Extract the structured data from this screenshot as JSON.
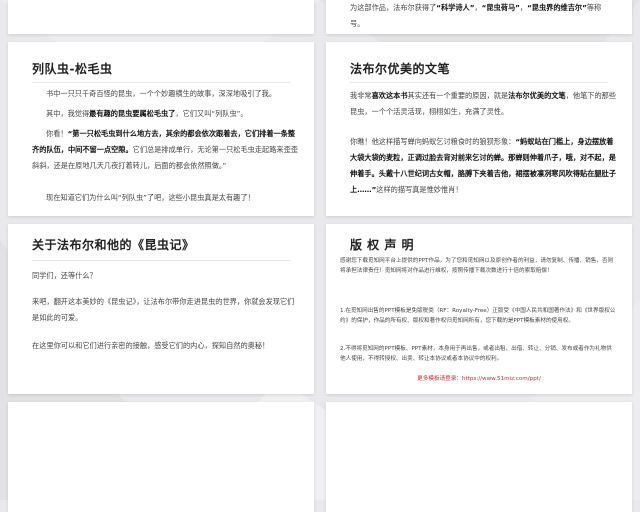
{
  "colors": {
    "accent": "#c8323c",
    "title": "#222222",
    "text": "#444444",
    "background": "#e9e9ec"
  },
  "top_left": {},
  "top_right": {
    "line_a": "为这部作品，法布尔获得了",
    "b1": "“科学诗人”",
    "sep1": "，",
    "b2": "“昆虫荷马”",
    "sep2": "，",
    "b3": "“昆虫界的维吉尔”",
    "tail": "等称号。"
  },
  "card_caterpillar": {
    "title": "列队虫-松毛虫",
    "p1": "书中一只只千奇百怪的昆虫，一个个妙趣横生的故事，深深地吸引了我。",
    "p2_a": "其中，我觉得",
    "p2_b": "最有趣的昆虫要属松毛虫了",
    "p2_c": "，它们又叫“列队虫”。",
    "p3_a": "你看！",
    "p3_b": "“第一只松毛虫到什么地方去，其余的都会依次跟着去，它们排着一条整齐的队伍，中间不留一点空隙。",
    "p3_c": "它们总是排成单行，无论第一只松毛虫走起路来歪歪斜斜，还是在原地几天几夜打着转儿，后面的都会依然照做。”",
    "p4": "现在知道它们为什么叫“列队虫”了吧，这些小昆虫真是太有趣了！"
  },
  "card_style": {
    "title": "法布尔优美的文笔",
    "p1_a": "我非常",
    "p1_b": "喜欢这本书",
    "p1_c": "其实还有一个重要的原因，就是",
    "p1_d": "法布尔优美的文笔",
    "p1_e": "，他笔下的那些昆虫，一个个活灵活现，栩栩如生，充满了灵性。",
    "p2_a": "你瞧！他这样描写蝉向蚂蚁乞讨粮食时的狼狈形象：",
    "p2_b": "“蚂蚁站在门槛上，身边摆放着大袋大袋的麦粒，正调过脸去背对前来乞讨的蝉。那蝉则伸着爪子，哦，对不起，是伸着手。头戴十八世纪词古女帽，胳膊下夹着吉他，裙摆被凛冽寒风吹得贴在腿肚子上……”",
    "p2_c": "这样的描写真是惟妙惟肖！"
  },
  "card_about": {
    "title": "关于法布尔和他的《昆虫记》",
    "p1": "同学们，还等什么？",
    "p2": "来吧，翻开这本美妙的《昆虫记》，让法布尔带你走进昆虫的世界，你就会发现它们是如此的可爱。",
    "p3": "在这里你可以和它们进行亲密的接触，感受它们的内心，探知自然的奥秘！"
  },
  "card_copyright": {
    "title": "版 权 声 明",
    "p1": "感谢您下载觅知网平台上提供的PPT作品，为了您和觅知网以及原创作者的利益，请勿复制、传播、销售，否则将承担法律责任！觅知网将对作品进行维权，按照传播下载次数进行十倍的索取赔偿！",
    "p2": "1.在觅知网出售的PPT模板是免版税类（RF：Royalty-Free）正版受《中国人民共和国著作法》和《世界版权公约》的保护，作品的所有权、版权和著作权归觅知网所有，您下载的是PPT模板素材的使用权。",
    "p3": "2.不得将觅知网的PPT模板、PPT素材，本身用于再出售，或者出租、出借、转让、分销、发布或者作为礼物供他人使用，不得转授权、出卖、转让本协议或者本协议中的权利。",
    "more_label": "更多模板请登录：",
    "more_url": "https://www.51miz.com/ppt/"
  }
}
